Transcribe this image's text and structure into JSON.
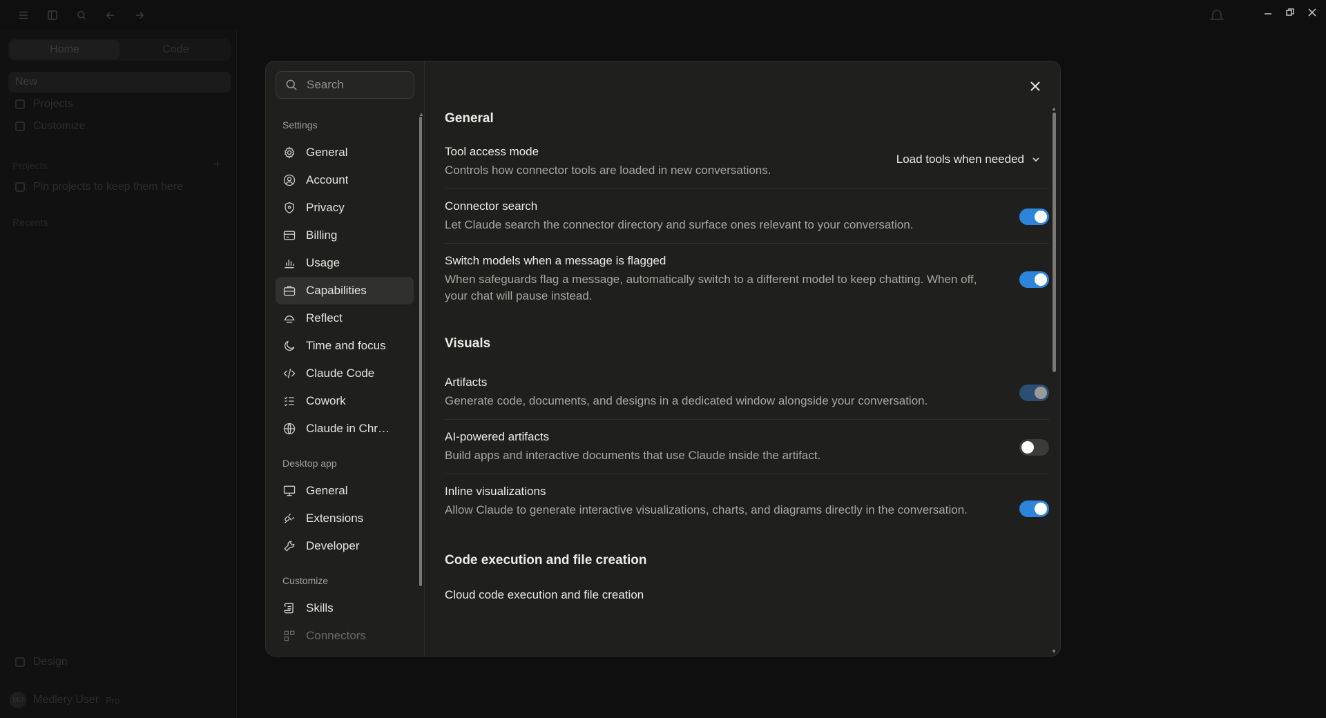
{
  "background_app": {
    "tabs": [
      "Home",
      "Code"
    ],
    "nav": [
      "New",
      "Projects",
      "Customize"
    ],
    "projects_label": "Projects",
    "projects_hint": "Pin projects to keep them here",
    "recents_label": "Recents",
    "design_label": "Design",
    "user_name": "Medlery User",
    "user_plan": "Pro",
    "user_initials": "MU"
  },
  "search": {
    "placeholder": "Search"
  },
  "nav": {
    "settings_label": "Settings",
    "settings_items": [
      "General",
      "Account",
      "Privacy",
      "Billing",
      "Usage",
      "Capabilities",
      "Reflect",
      "Time and focus",
      "Claude Code",
      "Cowork",
      "Claude in Chr…"
    ],
    "active_item": "Capabilities",
    "desktop_label": "Desktop app",
    "desktop_items": [
      "General",
      "Extensions",
      "Developer"
    ],
    "customize_label": "Customize",
    "customize_items": [
      "Skills",
      "Connectors"
    ]
  },
  "general": {
    "title": "General",
    "tool_access": {
      "title": "Tool access mode",
      "desc": "Controls how connector tools are loaded in new conversations.",
      "value": "Load tools when needed"
    },
    "connector_search": {
      "title": "Connector search",
      "desc": "Let Claude search the connector directory and surface ones relevant to your conversation.",
      "state": "on"
    },
    "switch_models": {
      "title": "Switch models when a message is flagged",
      "desc": "When safeguards flag a message, automatically switch to a different model to keep chatting. When off, your chat will pause instead.",
      "state": "on"
    }
  },
  "visuals": {
    "title": "Visuals",
    "artifacts": {
      "title": "Artifacts",
      "desc": "Generate code, documents, and designs in a dedicated window alongside your conversation.",
      "state": "on-disabled"
    },
    "ai_artifacts": {
      "title": "AI-powered artifacts",
      "desc": "Build apps and interactive documents that use Claude inside the artifact.",
      "state": "off"
    },
    "inline_viz": {
      "title": "Inline visualizations",
      "desc": "Allow Claude to generate interactive visualizations, charts, and diagrams directly in the conversation.",
      "state": "on"
    }
  },
  "code_exec": {
    "title": "Code execution and file creation",
    "first_row_title": "Cloud code execution and file creation"
  },
  "colors": {
    "accent": "#2c84db",
    "modal_bg": "#1f1f1e",
    "active_nav": "#30302e"
  }
}
